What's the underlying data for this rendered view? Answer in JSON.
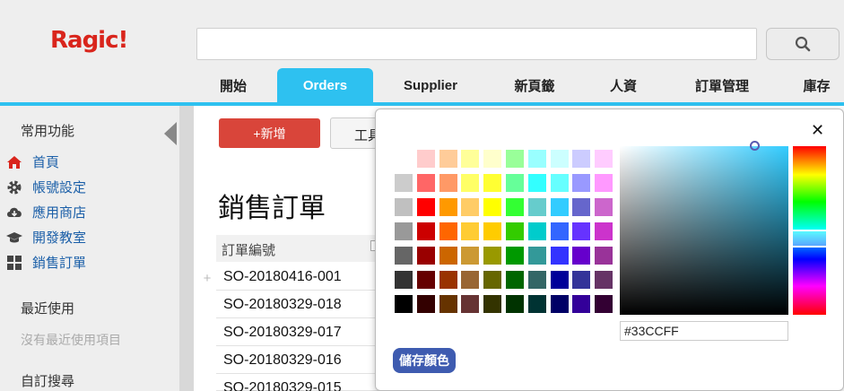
{
  "header": {
    "logo": "Ragic!",
    "search": {
      "placeholder": ""
    }
  },
  "tabs": [
    {
      "label": "開始"
    },
    {
      "label": "Orders"
    },
    {
      "label": "Supplier"
    },
    {
      "label": "新頁籤"
    },
    {
      "label": "人資"
    },
    {
      "label": "訂單管理"
    },
    {
      "label": "庫存"
    }
  ],
  "active_tab": "Orders",
  "sidebar": {
    "common_title": "常用功能",
    "items": [
      {
        "label": "首頁",
        "icon": "home-icon"
      },
      {
        "label": "帳號設定",
        "icon": "gear-icon"
      },
      {
        "label": "應用商店",
        "icon": "cloud-download-icon"
      },
      {
        "label": "開發教室",
        "icon": "graduation-cap-icon"
      },
      {
        "label": "銷售訂單",
        "icon": "grid-icon"
      }
    ],
    "recent_title": "最近使用",
    "recent_empty": "沒有最近使用項目",
    "custom_title": "自訂搜尋"
  },
  "main": {
    "new_button": "+新增",
    "tools_button": "工具",
    "title": "銷售訂單",
    "column_header": "訂單編號",
    "rows": [
      "SO-20180416-001",
      "SO-20180329-018",
      "SO-20180329-017",
      "SO-20180329-016",
      "SO-20180329-015"
    ]
  },
  "color_picker": {
    "hex_value": "#33CCFF",
    "save_label": "儲存顏色",
    "selected_color": "#33CCFF",
    "palette": [
      [
        "#ffffff",
        "#ffcccc",
        "#ffcc99",
        "#ffff99",
        "#ffffcc",
        "#99ff99",
        "#99ffff",
        "#ccffff",
        "#ccccff",
        "#ffccff"
      ],
      [
        "#cccccc",
        "#ff6666",
        "#ff9966",
        "#ffff66",
        "#ffff33",
        "#66ff99",
        "#33ffff",
        "#66ffff",
        "#9999ff",
        "#ff99ff"
      ],
      [
        "#c0c0c0",
        "#ff0000",
        "#ff9900",
        "#ffcc66",
        "#ffff00",
        "#33ff33",
        "#66cccc",
        "#33ccff",
        "#6666cc",
        "#cc66cc"
      ],
      [
        "#999999",
        "#cc0000",
        "#ff6600",
        "#ffcc33",
        "#ffcc00",
        "#33cc00",
        "#00cccc",
        "#3366ff",
        "#6633ff",
        "#cc33cc"
      ],
      [
        "#666666",
        "#990000",
        "#cc6600",
        "#cc9933",
        "#999900",
        "#009900",
        "#339999",
        "#3333ff",
        "#6600cc",
        "#993399"
      ],
      [
        "#333333",
        "#660000",
        "#993300",
        "#996633",
        "#666600",
        "#006600",
        "#336666",
        "#000099",
        "#333399",
        "#663366"
      ],
      [
        "#000000",
        "#330000",
        "#663300",
        "#663333",
        "#333300",
        "#003300",
        "#003333",
        "#000066",
        "#330099",
        "#330033"
      ]
    ]
  },
  "colors": {
    "brand_red": "#d9251c",
    "accent": "#2ec1f0",
    "new_button": "#d9453a",
    "save_button": "#3e5bb0"
  }
}
